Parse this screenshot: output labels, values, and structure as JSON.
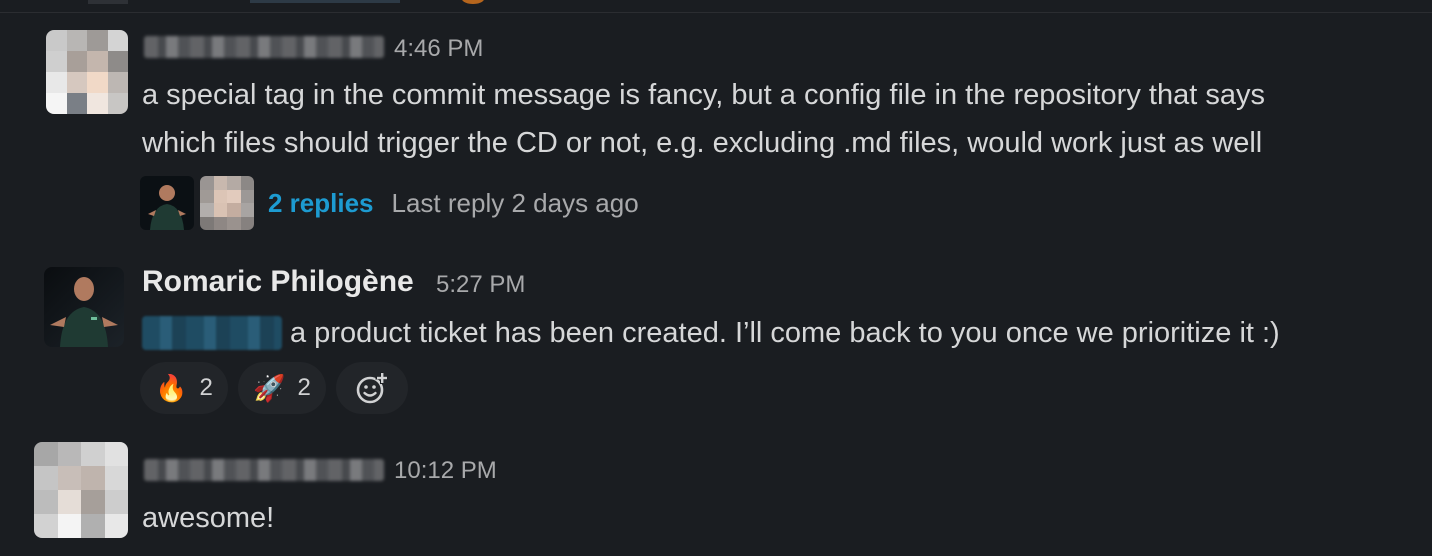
{
  "messages": [
    {
      "time": "4:46 PM",
      "lines": [
        "a special tag in the commit message is fancy, but a config file in the repository that says",
        "which files should trigger the CD or not, e.g. excluding .md files, would work just as well"
      ],
      "thread": {
        "replies_label": "2 replies",
        "last_reply_label": "Last reply 2 days ago"
      }
    },
    {
      "author": "Romaric Philogène",
      "time": "5:27 PM",
      "text": "a product ticket has been created. I’ll come back to you once we prioritize it :)",
      "reactions": [
        {
          "emoji": "🔥",
          "count": "2",
          "icon": "fire-emoji"
        },
        {
          "emoji": "🚀",
          "count": "2",
          "icon": "rocket-emoji"
        }
      ]
    },
    {
      "time": "10:12 PM",
      "text": "awesome!"
    }
  ],
  "colors": {
    "background": "#1a1d21",
    "link": "#1d9bd1",
    "reaction_bg": "#222529",
    "muted": "#a8a9ab"
  }
}
